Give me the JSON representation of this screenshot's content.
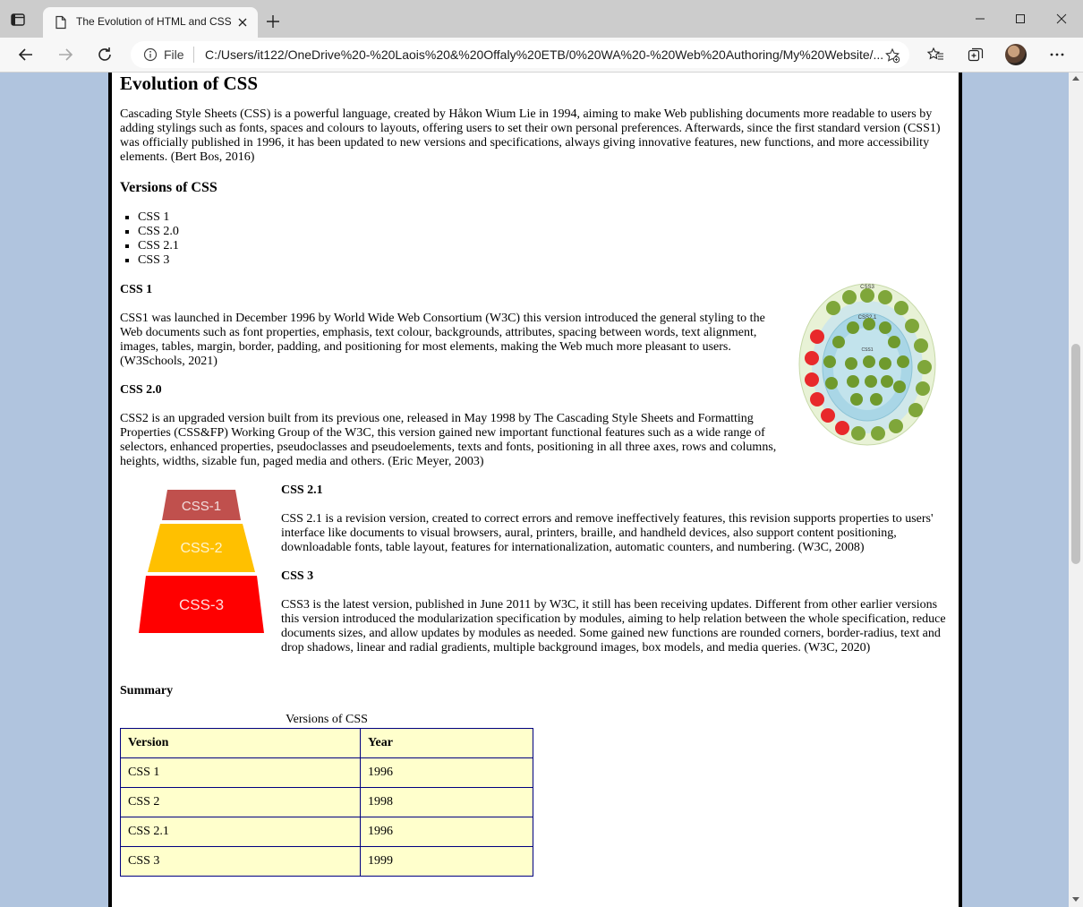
{
  "browser": {
    "tab_title": "The Evolution of HTML and CSS",
    "address_scheme": "File",
    "address_url": "C:/Users/it122/OneDrive%20-%20Laois%20&%20Offaly%20ETB/0%20WA%20-%20Web%20Authoring/My%20Website/..."
  },
  "page": {
    "title": "Evolution of CSS",
    "intro": "Cascading Style Sheets (CSS) is a powerful language, created by Håkon Wium Lie in 1994, aiming to make Web publishing documents more readable to users by adding stylings such as fonts, spaces and colours to layouts, offering users to set their own personal preferences. Afterwards, since the first standard version (CSS1) was officially published in 1996, it has been updated to new versions and specifications, always giving innovative features, new functions, and more accessibility elements. (Bert Bos, 2016)",
    "versions_heading": "Versions of CSS",
    "versions_list": [
      "CSS 1",
      "CSS 2.0",
      "CSS 2.1",
      "CSS 3"
    ],
    "css1_heading": "CSS 1",
    "css1_text": "CSS1 was launched in December 1996 by World Wide Web Consortium (W3C) this version introduced the general styling to the Web documents such as font properties, emphasis, text colour, backgrounds, attributes, spacing between words, text alignment, images, tables, margin, border, padding, and positioning for most elements, making the Web much more pleasant to users. (W3Schools, 2021)",
    "css20_heading": "CSS 2.0",
    "css20_text": "CSS2 is an upgraded version built from its previous one, released in May 1998 by The Cascading Style Sheets and Formatting Properties (CSS&FP) Working Group of the W3C, this version gained new important functional features such as a wide range of selectors, enhanced properties, pseudoclasses and pseudoelements, texts and fonts, positioning in all three axes, rows and columns, heights, widths, sizable fun, paged media and others. (Eric Meyer, 2003)",
    "css21_heading": "CSS 2.1",
    "css21_text": "CSS 2.1 is a revision version, created to correct errors and remove ineffectively features, this revision supports properties to users' interface like documents to visual browsers, aural, printers, braille, and handheld devices, also support content positioning, downloadable fonts, table layout, features for internationalization, automatic counters, and numbering. (W3C, 2008)",
    "css3_heading": "CSS 3",
    "css3_text": "CSS3 is the latest version, published in June 2011 by W3C, it still has been receiving updates. Different from other earlier versions this version introduced the modularization specification by modules, aiming to help relation between the whole specification, reduce documents sizes, and allow updates by modules as needed. Some gained new functions are rounded corners, border-radius, text and drop shadows, linear and radial gradients, multiple background images, box models, and media queries. (W3C, 2020)",
    "diagram_labels": {
      "outer": "CSS3",
      "middle": "CSS2.1",
      "inner": "CSS1"
    },
    "pyramid_labels": [
      "CSS-1",
      "CSS-2",
      "CSS-3"
    ],
    "summary_heading": "Summary",
    "table": {
      "caption": "Versions of CSS",
      "headers": [
        "Version",
        "Year"
      ],
      "rows": [
        [
          "CSS 1",
          "1996"
        ],
        [
          "CSS 2",
          "1998"
        ],
        [
          "CSS 2.1",
          "1996"
        ],
        [
          "CSS 3",
          "1999"
        ]
      ]
    }
  },
  "colors": {
    "page_background": "#b0c4de",
    "table_fill": "#ffffcc",
    "table_border": "#000080",
    "pyramid": [
      "#c0504d",
      "#ffc000",
      "#ff0000"
    ]
  }
}
